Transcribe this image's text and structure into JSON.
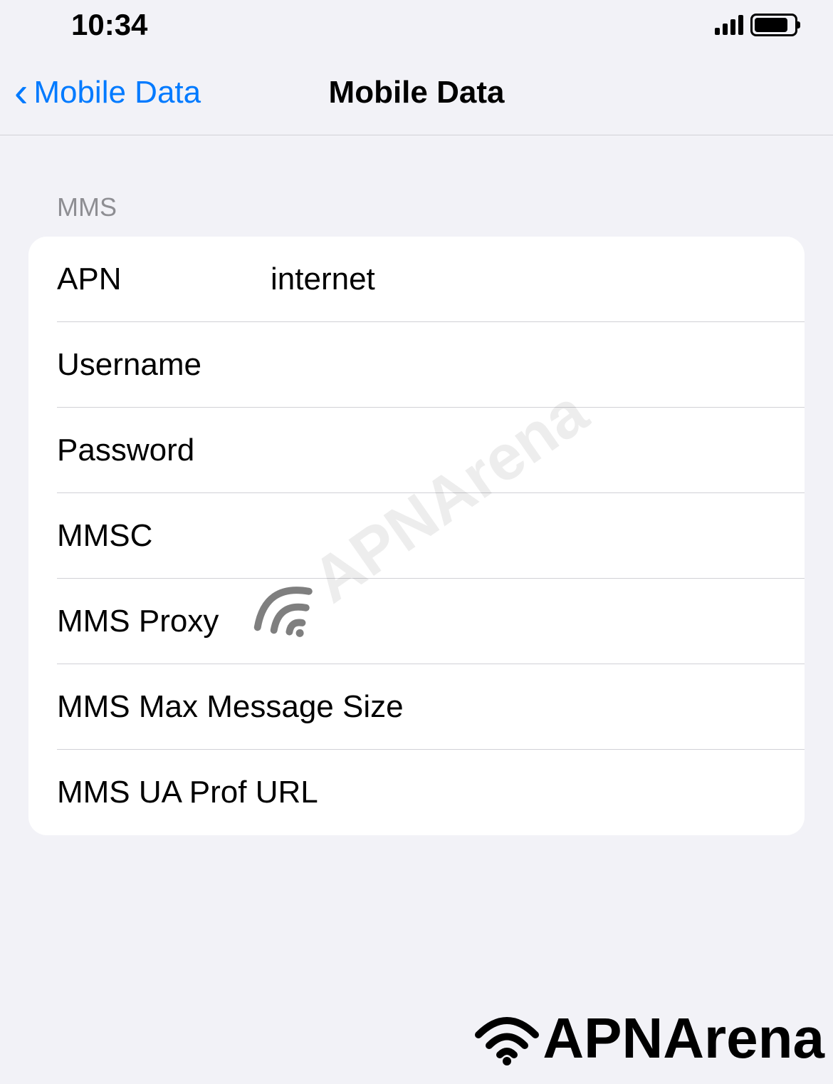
{
  "status_bar": {
    "time": "10:34"
  },
  "nav": {
    "back_label": "Mobile Data",
    "title": "Mobile Data"
  },
  "section": {
    "header": "MMS",
    "rows": [
      {
        "label": "APN",
        "value": "internet"
      },
      {
        "label": "Username",
        "value": ""
      },
      {
        "label": "Password",
        "value": ""
      },
      {
        "label": "MMSC",
        "value": ""
      },
      {
        "label": "MMS Proxy",
        "value": ""
      },
      {
        "label": "MMS Max Message Size",
        "value": ""
      },
      {
        "label": "MMS UA Prof URL",
        "value": ""
      }
    ]
  },
  "watermark": {
    "text": "APNArena",
    "logo_text": "APNArena"
  }
}
